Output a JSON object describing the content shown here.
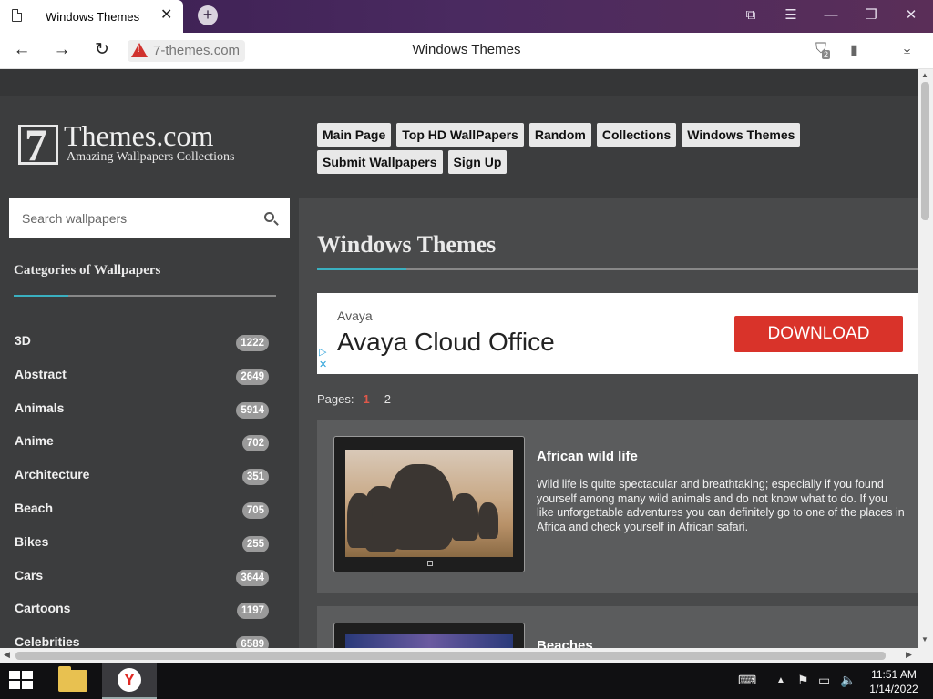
{
  "browser": {
    "tab_title": "Windows Themes",
    "url": "7-themes.com",
    "page_heading": "Windows Themes",
    "downloads_count": "2"
  },
  "site": {
    "logo_mark": "7",
    "logo_name": "Themes.com",
    "logo_tagline": "Amazing Wallpapers Collections",
    "menu": [
      "Main Page",
      "Top HD WallPapers",
      "Random",
      "Collections",
      "Windows Themes",
      "Submit Wallpapers",
      "Sign Up"
    ],
    "search_placeholder": "Search wallpapers"
  },
  "sidebar": {
    "title": "Categories of Wallpapers",
    "categories": [
      {
        "name": "3D",
        "count": "1222"
      },
      {
        "name": "Abstract",
        "count": "2649"
      },
      {
        "name": "Animals",
        "count": "5914"
      },
      {
        "name": "Anime",
        "count": "702"
      },
      {
        "name": "Architecture",
        "count": "351"
      },
      {
        "name": "Beach",
        "count": "705"
      },
      {
        "name": "Bikes",
        "count": "255"
      },
      {
        "name": "Cars",
        "count": "3644"
      },
      {
        "name": "Cartoons",
        "count": "1197"
      },
      {
        "name": "Celebrities",
        "count": "6589"
      }
    ]
  },
  "main": {
    "title": "Windows Themes",
    "ad": {
      "brand": "Avaya",
      "headline": "Avaya Cloud Office",
      "cta": "DOWNLOAD"
    },
    "pages_label": "Pages:",
    "pages": [
      "1",
      "2"
    ],
    "items": [
      {
        "title": "African wild life",
        "description": "Wild life is quite spectacular and breathtaking; especially if you found yourself among many wild animals and do not know what to do. If you like unforgettable adventures you can definitely go to one of the places in Africa and check yourself in African safari."
      },
      {
        "title": "Beaches"
      }
    ]
  },
  "taskbar": {
    "time": "11:51 AM",
    "date": "1/14/2022"
  },
  "colors": {
    "accent_rule": "#3ab0c0",
    "page_bg": "#3c3d3e",
    "ad_cta": "#d9332a",
    "current_page": "#e0584a"
  }
}
